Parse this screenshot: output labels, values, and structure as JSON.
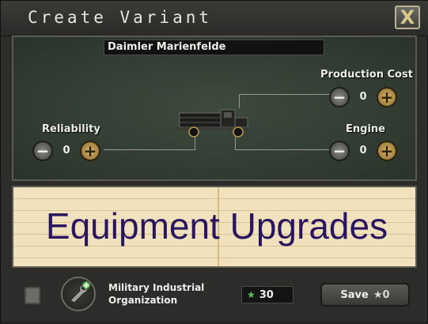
{
  "window": {
    "title": "Create Variant",
    "close_label": "X"
  },
  "variant": {
    "name": "Daimler Marienfelde"
  },
  "stats": {
    "production_cost": {
      "label": "Production Cost",
      "value": "0",
      "minus": "−",
      "plus": "+"
    },
    "reliability": {
      "label": "Reliability",
      "value": "0",
      "minus": "−",
      "plus": "+"
    },
    "engine": {
      "label": "Engine",
      "value": "0",
      "minus": "−",
      "plus": "+"
    }
  },
  "upgrades": {
    "title": "Equipment Upgrades"
  },
  "footer": {
    "org_line1": "Military Industrial",
    "org_line2": "Organization",
    "xp_value": "30",
    "save_label": "Save",
    "save_cost": "0",
    "star_symbol": "★"
  },
  "colors": {
    "accent": "#d8b46a",
    "paper": "#f0e2bc",
    "upgrade_text": "#2a1660"
  }
}
